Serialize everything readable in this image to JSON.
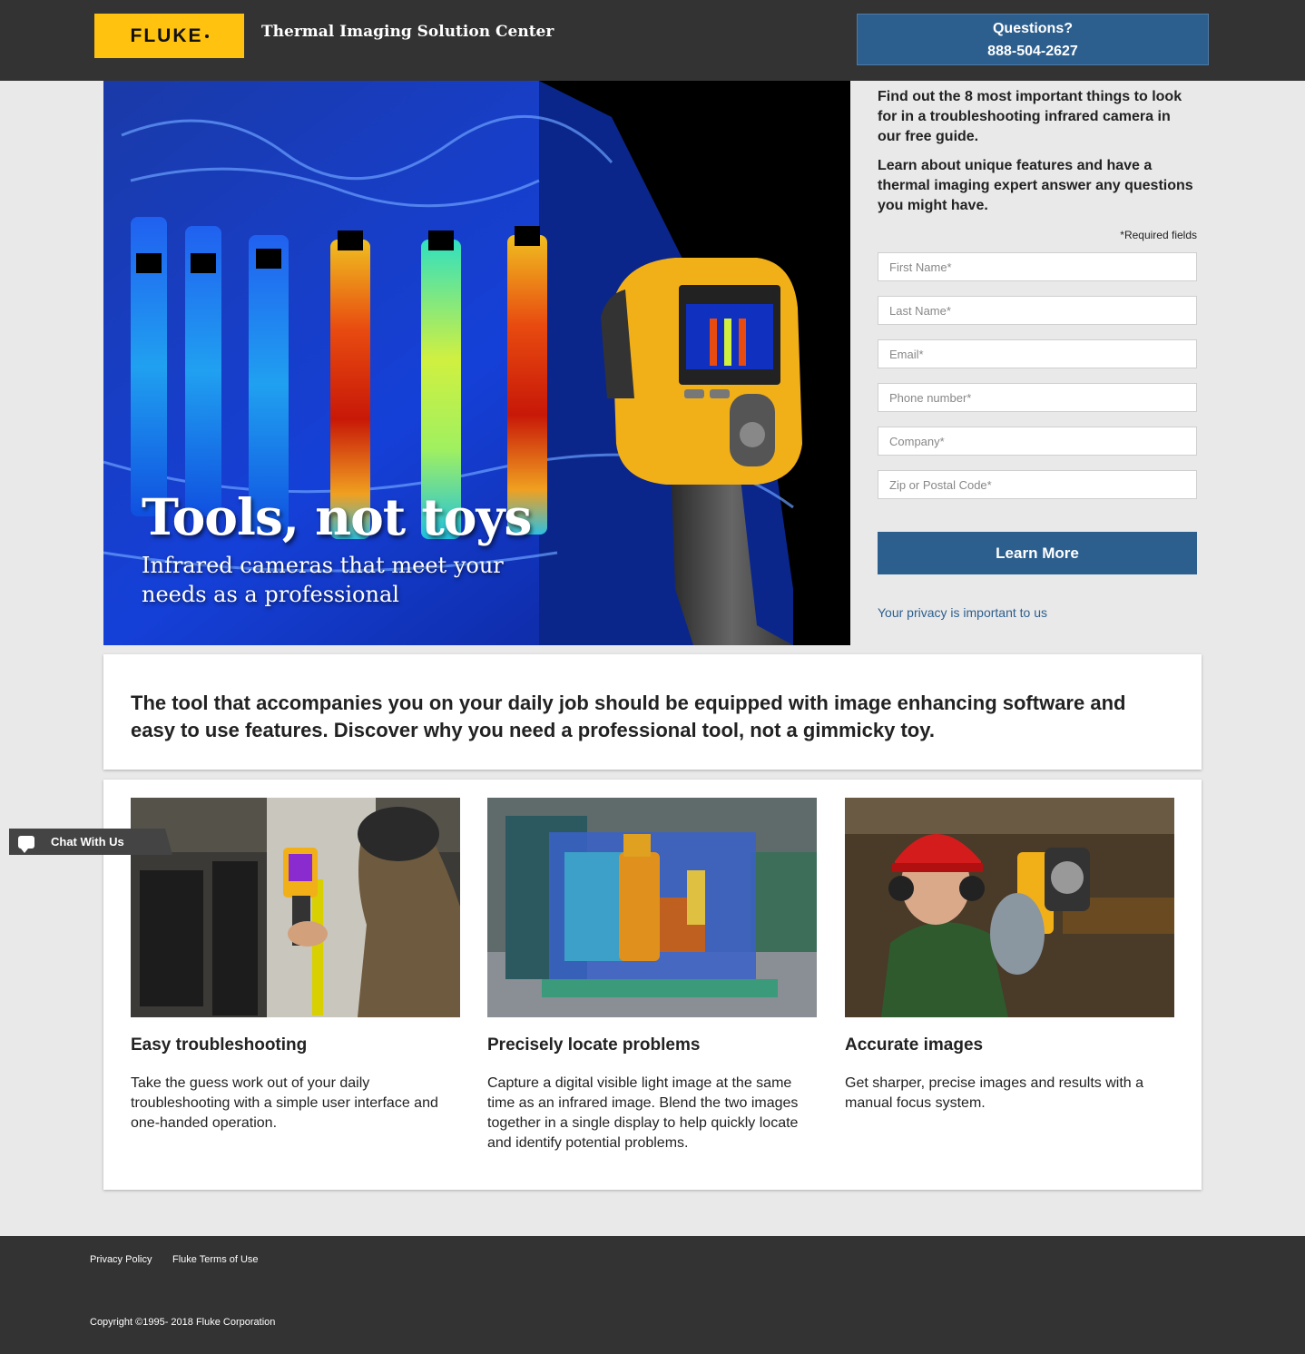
{
  "header": {
    "logo_text": "FLUKE",
    "site_title": "Thermal Imaging Solution Center",
    "questions_label": "Questions?",
    "phone": "888-504-2627"
  },
  "hero": {
    "title": "Tools, not toys",
    "subtitle": "Infrared cameras that meet your needs as a professional"
  },
  "form": {
    "intro_1": "Find out the 8 most important things to look for in a troubleshooting infrared camera in our free guide.",
    "intro_2": "Learn about unique features and have a thermal imaging expert answer any questions you might have.",
    "required_note": "*Required fields",
    "fields": {
      "first_name": "First Name*",
      "last_name": "Last Name*",
      "email": "Email*",
      "phone": "Phone number*",
      "company": "Company*",
      "zip": "Zip or Postal Code*"
    },
    "submit_label": "Learn More",
    "privacy_link": "Your privacy is important to us"
  },
  "banner": {
    "text": "The tool that accompanies you on your daily job should be equipped with image enhancing software and easy to use features. Discover why you need a professional tool, not a gimmicky toy."
  },
  "features": [
    {
      "title": "Easy troubleshooting",
      "text": "Take the guess work out of your daily troubleshooting with a simple user interface and one-handed operation."
    },
    {
      "title": "Precisely locate problems",
      "text": "Capture a digital visible light image at the same time as an infrared image. Blend the two images together in a single display to help quickly locate and identify potential problems."
    },
    {
      "title": "Accurate images",
      "text": "Get sharper, precise images and results with a manual focus system."
    }
  ],
  "chat": {
    "label": "Chat With Us"
  },
  "footer": {
    "privacy": "Privacy Policy",
    "terms": "Fluke Terms of Use",
    "copyright": "Copyright ©1995- 2018 Fluke Corporation"
  },
  "colors": {
    "brand_yellow": "#ffc20e",
    "accent_blue": "#2d5f8e",
    "dark_bar": "#333333"
  }
}
